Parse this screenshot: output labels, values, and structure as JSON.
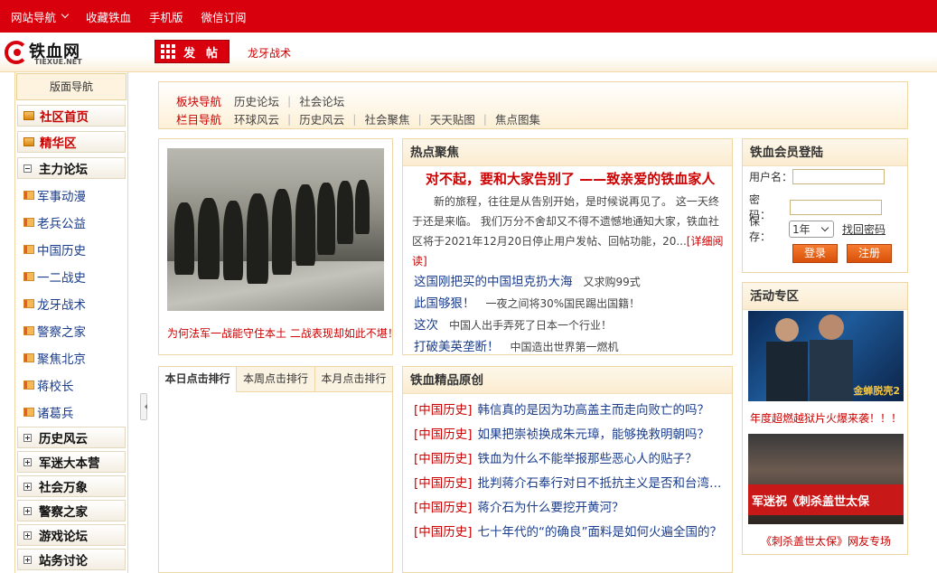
{
  "topbar": {
    "site_nav": "网站导航",
    "bookmark": "收藏铁血",
    "mobile": "手机版",
    "wechat": "微信订阅"
  },
  "header": {
    "logo_cn": "铁血网",
    "logo_en": "TIEXUE.NET",
    "post_button": "发帖",
    "forum_link": "龙牙战术"
  },
  "sidebar": {
    "title": "版面导航",
    "top_items": [
      {
        "label": "社区首页"
      },
      {
        "label": "精华区"
      }
    ],
    "main_forum": "主力论坛",
    "sub_items": [
      "军事动漫",
      "老兵公益",
      "中国历史",
      "一二战史",
      "龙牙战术",
      "警察之家",
      "聚焦北京",
      "蒋校长",
      "诸葛兵"
    ],
    "groups": [
      "历史风云",
      "军迷大本营",
      "社会万象",
      "警察之家",
      "游戏论坛",
      "站务讨论"
    ]
  },
  "nav": {
    "block_label": "板块导航",
    "block_items": [
      "历史论坛",
      "社会论坛"
    ],
    "column_label": "栏目导航",
    "column_items": [
      "环球风云",
      "历史风云",
      "社会聚焦",
      "天天贴图",
      "焦点图集"
    ]
  },
  "hot": {
    "caption": "为何法军一战能守住本土 二战表现却如此不堪！"
  },
  "focus": {
    "title": "热点聚焦",
    "headline": "对不起，要和大家告别了 ——致亲爱的铁血家人",
    "body": "新的旅程，往往是从告别开始，是时候说再见了。 这一天终于还是来临。 我们万分不舍却又不得不遗憾地通知大家，铁血社区将于2021年12月20日停止用户发帖、回帖功能，20...",
    "more": "[详细阅读]",
    "items": [
      {
        "title": "这国刚把买的中国坦克扔大海",
        "desc": "又求购99式"
      },
      {
        "title": "此国够狠！",
        "desc": "一夜之间将30%国民踢出国籍！"
      },
      {
        "title": "这次",
        "desc": "中国人出手弄死了日本一个行业！"
      },
      {
        "title": "打破美英垄断！",
        "desc": "中国造出世界第一燃机"
      }
    ]
  },
  "ranking": {
    "tabs": [
      "本日点击排行",
      "本周点击排行",
      "本月点击排行"
    ],
    "active_tab": 0
  },
  "original": {
    "title": "铁血精品原创",
    "items": [
      {
        "tag": "[中国历史]",
        "title": "韩信真的是因为功高盖主而走向败亡的吗？"
      },
      {
        "tag": "[中国历史]",
        "title": "如果把崇祯换成朱元璋，能够挽救明朝吗？"
      },
      {
        "tag": "[中国历史]",
        "title": "铁血为什么不能举报那些恶心人的贴子？"
      },
      {
        "tag": "[中国历史]",
        "title": "批判蒋介石奉行对日不抵抗主义是否和台湾…"
      },
      {
        "tag": "[中国历史]",
        "title": "蒋介石为什么要挖开黄河？"
      },
      {
        "tag": "[中国历史]",
        "title": "七十年代的“的确良”面料是如何火遍全国的？"
      }
    ]
  },
  "login": {
    "title": "铁血会员登陆",
    "username_label": "用户名：",
    "password_label": "密　码：",
    "save_label": "保　存：",
    "save_option": "1年",
    "recover_link": "找回密码",
    "login_button": "登录",
    "register_button": "注册"
  },
  "activity": {
    "title": "活动专区",
    "items": [
      {
        "caption": "年度超燃越狱片火爆来袭！！！",
        "poster_text": "金蝉脱壳2"
      },
      {
        "caption": "《刺杀盖世太保》网友专场",
        "poster_text": "军迷祝《刺杀盖世太保"
      }
    ]
  }
}
